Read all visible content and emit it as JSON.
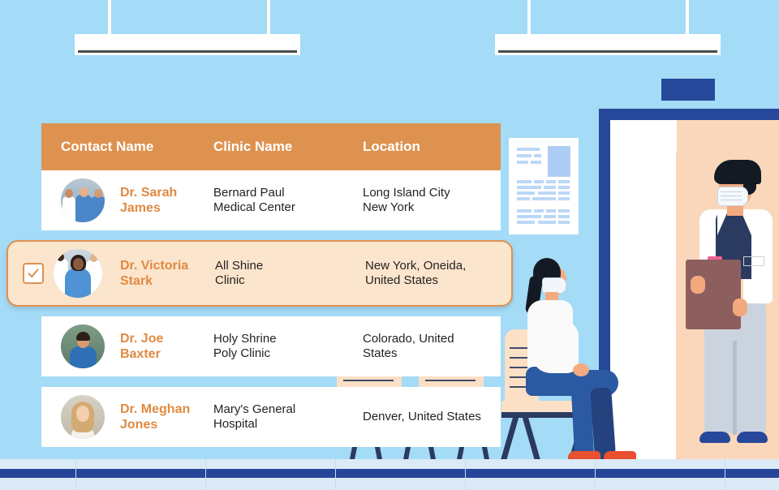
{
  "scene": {
    "wall_color": "#A4DBF7",
    "floor_color": "#DBEAF6",
    "floor_strip_color": "#27469A",
    "door_frame_color": "#27489A",
    "door_sign_color": "#27489A"
  },
  "table": {
    "header_bg": "#DE9250",
    "header_text_color": "#FFFFFF",
    "row_bg": "#FFFFFF",
    "selected_row_bg": "#FCE5CD",
    "selected_row_border": "#DE9250",
    "name_color": "#E08A42",
    "columns": [
      {
        "key": "contact_name",
        "label": "Contact Name"
      },
      {
        "key": "clinic_name",
        "label": "Clinic Name"
      },
      {
        "key": "location",
        "label": "Location"
      }
    ],
    "rows": [
      {
        "contact_name": "Dr. Sarah\nJames",
        "clinic_name": "Bernard Paul\nMedical Center",
        "location": "Long Island City\nNew York",
        "selected": false,
        "avatar": "group-of-doctors-photo"
      },
      {
        "contact_name": "Dr. Victoria\nStark",
        "clinic_name": "All Shine\nClinic",
        "location": "New York, Oneida,\nUnited States",
        "selected": true,
        "checkbox_state": "checked",
        "avatar": "female-doctor-photo"
      },
      {
        "contact_name": "Dr. Joe\nBaxter",
        "clinic_name": "Holy Shrine\nPoly Clinic",
        "location": "Colorado, United\nStates",
        "selected": false,
        "avatar": "male-doctor-photo"
      },
      {
        "contact_name": "Dr. Meghan\nJones",
        "clinic_name": "Mary's General\nHospital",
        "location": "Denver, United States",
        "selected": false,
        "avatar": "female-blonde-doctor-photo"
      }
    ]
  },
  "illustration": {
    "lamps": 2,
    "poster": "medical-information-poster",
    "standing_doctor": "masked-doctor-with-clipboard",
    "seated_patient": "masked-woman-on-bench",
    "doorway": "clinic-doorway"
  }
}
